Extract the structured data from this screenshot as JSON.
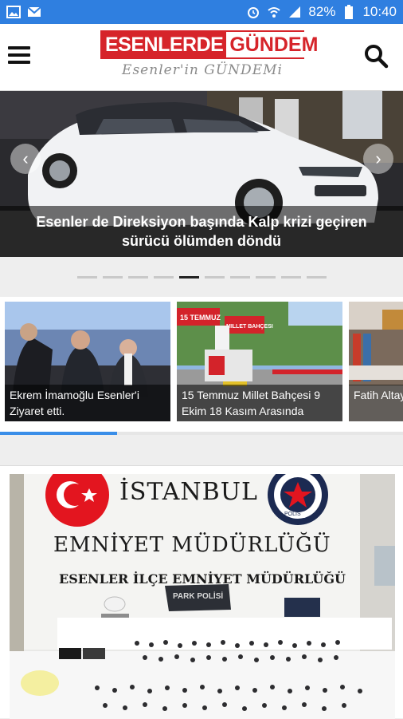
{
  "status_bar": {
    "battery": "82%",
    "time": "10:40",
    "icons": [
      "image-icon",
      "mail-icon",
      "alarm-icon",
      "wifi-icon",
      "signal-icon",
      "battery-icon"
    ]
  },
  "header": {
    "logo_part1": "ESENLERDE",
    "logo_part2": "GÜNDEM",
    "tagline": "Esenler'in GÜNDEMi",
    "menu_icon": "hamburger-menu-icon",
    "search_icon": "search-icon"
  },
  "hero": {
    "caption": "Esenler de Direksiyon başında Kalp krizi geçiren sürücü ölümden döndü",
    "prev_icon": "chevron-left-icon",
    "next_icon": "chevron-right-icon",
    "slide_count": 10,
    "active_slide": 5
  },
  "cards": [
    {
      "caption": "Ekrem İmamoğlu Esenler'i Ziyaret etti."
    },
    {
      "caption": "15 Temmuz Millet Bahçesi 9 Ekim 18 Kasım Arasında Kapalı",
      "sign1": "15 TEMMUZ",
      "sign2": "MILLET BAHÇESI"
    },
    {
      "caption": "Fatih Altaylı değil, Ham"
    }
  ],
  "scroll_progress": 0.29,
  "article": {
    "sign_city": "İSTANBUL",
    "sign_title": "EMNİYET MÜDÜRLÜĞÜ",
    "sign_sub": "ESENLER İLÇE EMNİYET MÜDÜRLÜĞÜ",
    "bag_label": "PARK POLİSİ",
    "seal_text": "POLİS"
  },
  "colors": {
    "status_bar": "#2f7fe0",
    "brand_red": "#d6242a",
    "progress": "#3a8ee8"
  }
}
